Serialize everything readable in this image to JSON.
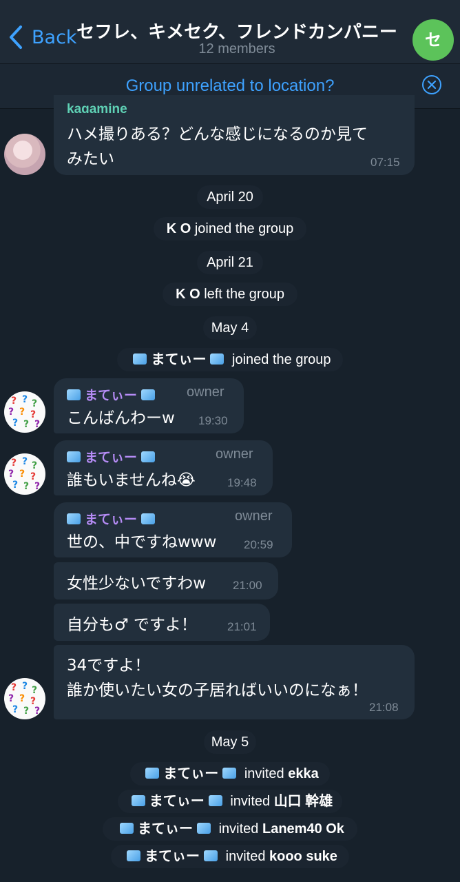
{
  "header": {
    "back_label": "Back",
    "title": "セフレ、キメセク、フレンドカンパニー",
    "subtitle": "12 members",
    "avatar_letter": "セ",
    "avatar_color": "#5cc35a"
  },
  "banner": {
    "text": "Group unrelated to location?"
  },
  "messages": [
    {
      "sender": "kagamine",
      "lines": [
        "ハメ撮りある？どんな感じになるのか見て",
        "みたい"
      ],
      "time": "07:15"
    },
    {
      "sender": "まてぃー",
      "role": "owner",
      "text": "こんばんわーw",
      "time": "19:30"
    },
    {
      "sender": "まてぃー",
      "role": "owner",
      "text": "誰もいませんね😭",
      "time": "19:48"
    },
    {
      "sender": "まてぃー",
      "role": "owner",
      "text": "世の、中ですねwww",
      "time": "20:59"
    },
    {
      "text": "女性少ないですわw",
      "time": "21:00"
    },
    {
      "text": "自分も♂ ですよ！",
      "time": "21:01"
    },
    {
      "lines": [
        "34ですよ！",
        "誰か使いたい女の子居ればいいのになぁ！"
      ],
      "time": "21:08"
    }
  ],
  "service": {
    "date_apr20": "April 20",
    "ko": "K O",
    "joined": "joined the group",
    "date_apr21": "April 21",
    "left": "left the group",
    "date_may4": "May 4",
    "mate": "まてぃー",
    "date_may5": "May 5",
    "invited": "invited",
    "invitees": [
      "ekka",
      "山口 幹雄",
      "Lanem40 Ok",
      "kooo suke"
    ]
  },
  "colors": {
    "accent": "#3ea2ff",
    "background": "#17212b",
    "bubble": "#222f3c",
    "sender_name": "#b68cf6"
  }
}
